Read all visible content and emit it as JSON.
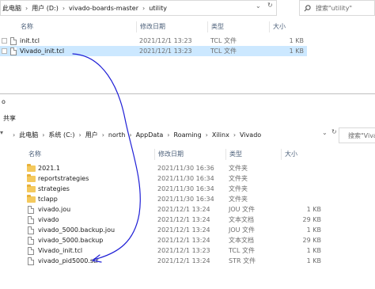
{
  "window1": {
    "breadcrumb": [
      "此电脑",
      "用户 (D:)",
      "vivado-boards-master",
      "utility"
    ],
    "search_placeholder": "搜索\"utility\"",
    "columns": {
      "name": "名称",
      "date": "修改日期",
      "type": "类型",
      "size": "大小"
    },
    "files": [
      {
        "name": "init.tcl",
        "date": "2021/12/1 13:23",
        "type": "TCL 文件",
        "size": "1 KB",
        "kind": "file",
        "selected": false
      },
      {
        "name": "Vivado_init.tcl",
        "date": "2021/12/1 13:23",
        "type": "TCL 文件",
        "size": "1 KB",
        "kind": "file",
        "selected": true
      }
    ]
  },
  "window2": {
    "title": "o",
    "ribbon_tab": "共享",
    "breadcrumb": [
      "此电脑",
      "系统 (C:)",
      "用户",
      "north",
      "AppData",
      "Roaming",
      "Xilinx",
      "Vivado"
    ],
    "search_placeholder": "搜索\"Vivado",
    "columns": {
      "name": "名称",
      "date": "修改日期",
      "type": "类型",
      "size": "大小"
    },
    "files": [
      {
        "name": "2021.1",
        "date": "2021/11/30 16:36",
        "type": "文件夹",
        "size": "",
        "kind": "folder"
      },
      {
        "name": "reportstrategies",
        "date": "2021/11/30 16:34",
        "type": "文件夹",
        "size": "",
        "kind": "folder"
      },
      {
        "name": "strategies",
        "date": "2021/11/30 16:34",
        "type": "文件夹",
        "size": "",
        "kind": "folder"
      },
      {
        "name": "tclapp",
        "date": "2021/11/30 16:34",
        "type": "文件夹",
        "size": "",
        "kind": "folder"
      },
      {
        "name": "vivado.jou",
        "date": "2021/12/1 13:24",
        "type": "JOU 文件",
        "size": "1 KB",
        "kind": "file"
      },
      {
        "name": "vivado",
        "date": "2021/12/1 13:24",
        "type": "文本文档",
        "size": "29 KB",
        "kind": "file"
      },
      {
        "name": "vivado_5000.backup.jou",
        "date": "2021/12/1 13:24",
        "type": "JOU 文件",
        "size": "1 KB",
        "kind": "file"
      },
      {
        "name": "vivado_5000.backup",
        "date": "2021/12/1 13:24",
        "type": "文本文档",
        "size": "29 KB",
        "kind": "file"
      },
      {
        "name": "Vivado_init.tcl",
        "date": "2021/12/1 13:23",
        "type": "TCL 文件",
        "size": "1 KB",
        "kind": "file"
      },
      {
        "name": "vivado_pid5000.str",
        "date": "2021/12/1 13:24",
        "type": "STR 文件",
        "size": "1 KB",
        "kind": "file"
      }
    ]
  },
  "colors": {
    "selected_row": "#cce8ff",
    "arrow": "#1f1fd6",
    "folder": "#f4c95d"
  }
}
